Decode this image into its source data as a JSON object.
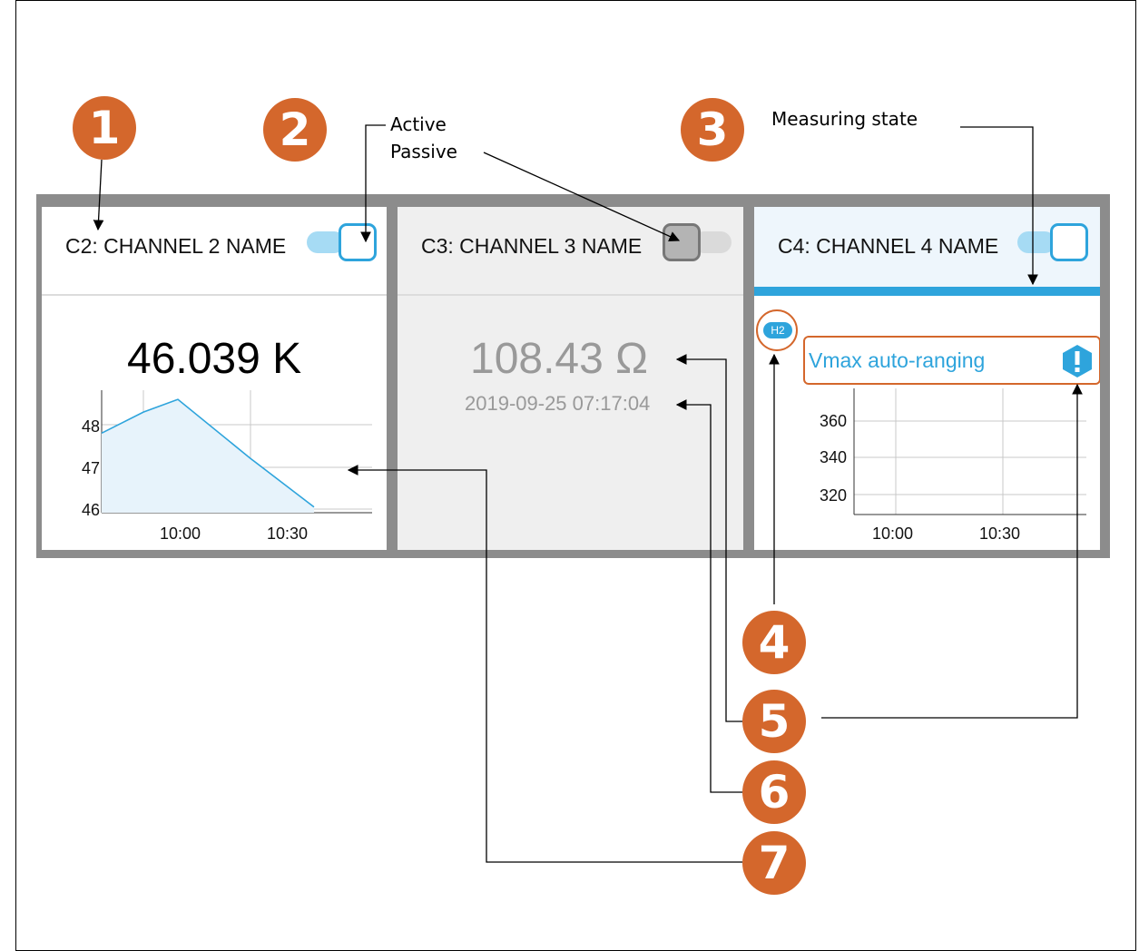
{
  "callouts": [
    "1",
    "2",
    "3",
    "4",
    "5",
    "6",
    "7"
  ],
  "labels": {
    "active": "Active",
    "passive": "Passive",
    "measuring_state": "Measuring state"
  },
  "colors": {
    "callout": "#d4672c",
    "accent": "#2ea4dc",
    "panel_border": "#8c8c8c",
    "passive_bg": "#efefef"
  },
  "channels": [
    {
      "title": "C2: CHANNEL 2 NAME",
      "toggle": "on",
      "value": "46.039 K",
      "chart": {
        "type": "area",
        "x_ticks": [
          "10:00",
          "10:30"
        ],
        "y_ticks": [
          "48",
          "47",
          "46"
        ]
      }
    },
    {
      "title": "C3: CHANNEL 3 NAME",
      "toggle": "off",
      "value": "108.43 Ω",
      "timestamp": "2019-09-25 07:17:04"
    },
    {
      "title": "C4: CHANNEL 4 NAME",
      "toggle": "on",
      "badge": "H2",
      "alert": {
        "text": "Vmax auto-ranging",
        "icon": "exclamation-icon"
      },
      "chart": {
        "type": "line",
        "x_ticks": [
          "10:00",
          "10:30"
        ],
        "y_ticks": [
          "360",
          "340",
          "320"
        ]
      }
    }
  ],
  "chart_data": [
    {
      "type": "area",
      "x": [
        "09:45",
        "10:00",
        "10:15",
        "10:30",
        "10:45"
      ],
      "values": [
        47.8,
        48.3,
        48.6,
        47.2,
        46.05
      ],
      "x_tick_labels": [
        "10:00",
        "10:30"
      ],
      "y_tick_labels": [
        "48",
        "47",
        "46"
      ],
      "ylim": [
        45.9,
        49.0
      ]
    },
    {
      "type": "line",
      "x_tick_labels": [
        "10:00",
        "10:30"
      ],
      "y_tick_labels": [
        "360",
        "340",
        "320"
      ],
      "values": []
    }
  ]
}
